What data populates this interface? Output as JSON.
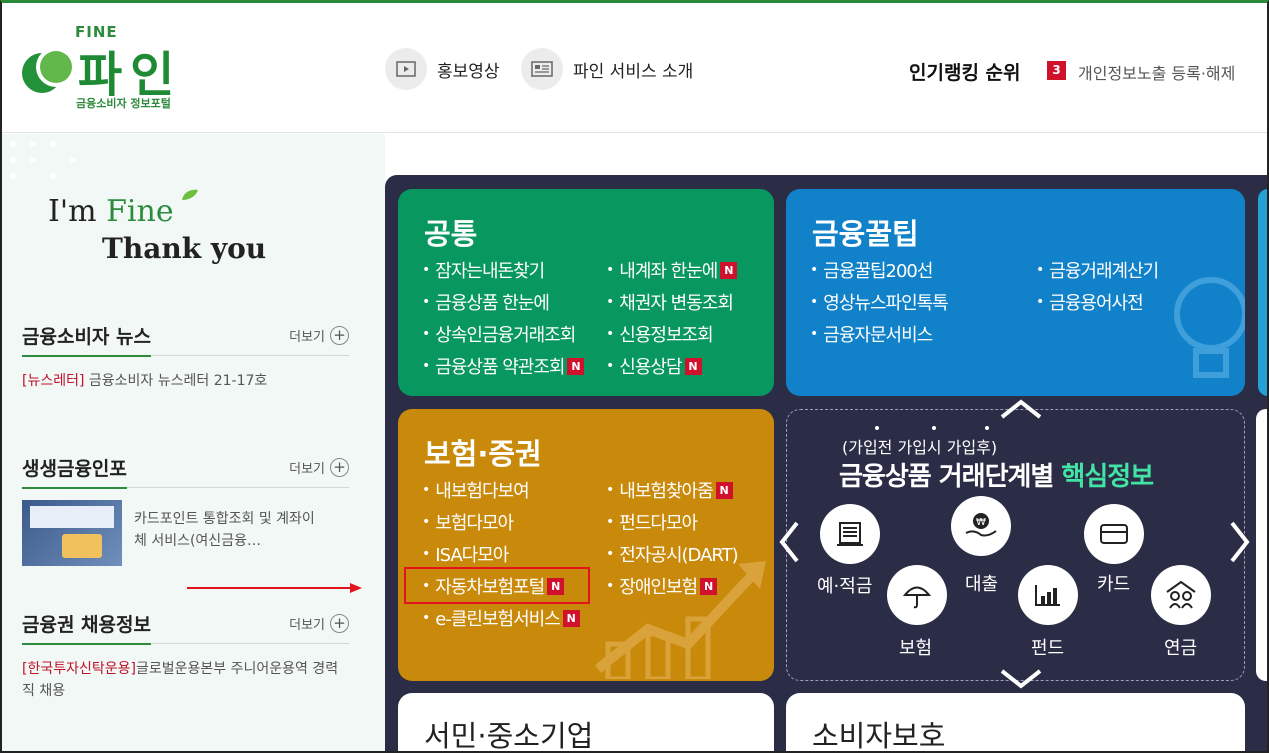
{
  "header": {
    "logo_small": "FINE",
    "logo_name": "파인",
    "logo_sub": "금융소비자 정보포털",
    "promo_video": "홍보영상",
    "service_intro": "파인 서비스 소개",
    "ranking_title": "인기랭킹 순위",
    "ranking_number": "3",
    "ranking_item": "개인정보노출 등록·해제"
  },
  "left": {
    "slogan_fine_prefix": "I'm",
    "slogan_fine": "Fine",
    "slogan_thanks": "Thank you",
    "more_label": "더보기",
    "sections": [
      {
        "title": "금융소비자 뉴스",
        "tag": "[뉴스레터]",
        "text": "금융소비자 뉴스레터 21-17호"
      },
      {
        "title": "생생금융인포",
        "text": "카드포인트 통합조회 및 계좌이체 서비스(여신금융…"
      },
      {
        "title": "금융권 채용정보",
        "tag": "[한국투자신탁운용]",
        "text": "글로벌운용본부 주니어운용역 경력직 채용"
      }
    ]
  },
  "tiles": {
    "common": {
      "title": "공통",
      "items": [
        "잠자는내돈찾기",
        "내계좌 한눈에",
        "금융상품 한눈에",
        "채권자 변동조회",
        "상속인금융거래조회",
        "신용정보조회",
        "금융상품 약관조회",
        "신용상담"
      ]
    },
    "tip": {
      "title": "금융꿀팁",
      "items": [
        "금융꿀팁200선",
        "금융거래계산기",
        "영상뉴스파인톡톡",
        "금융용어사전",
        "금융자문서비스"
      ]
    },
    "insurance": {
      "title": "보험·증권",
      "items": [
        "내보험다보여",
        "내보험찾아줌",
        "보험다모아",
        "펀드다모아",
        "ISA다모아",
        "전자공시(DART)",
        "자동차보험포털",
        "장애인보험",
        "e-클린보험서비스"
      ]
    },
    "core": {
      "subtitle": "(가입전 가입시 가입후)",
      "title_main": "금융상품 거래단계별",
      "title_accent": "핵심정보",
      "labels": [
        "예·적금",
        "대출",
        "카드",
        "보험",
        "펀드",
        "연금"
      ]
    },
    "small_biz": {
      "title": "서민·중소기업"
    },
    "consumer": {
      "title": "소비자보호"
    },
    "new_badge": "N"
  }
}
